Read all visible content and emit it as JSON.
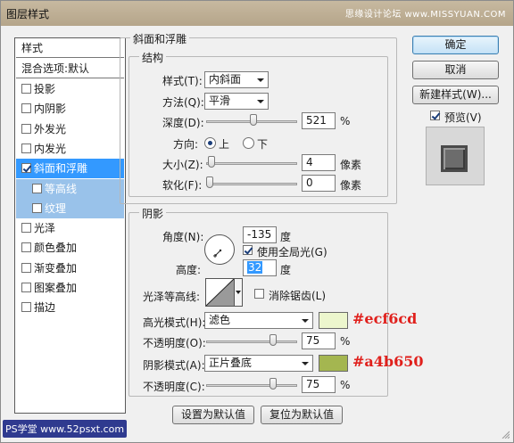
{
  "window": {
    "title": "图层样式",
    "watermark": "思缘设计论坛 www.MISSYUAN.COM"
  },
  "style_list": {
    "header": "样式",
    "blend": "混合选项:默认",
    "items": [
      {
        "label": "投影",
        "checked": false
      },
      {
        "label": "内阴影",
        "checked": false
      },
      {
        "label": "外发光",
        "checked": false
      },
      {
        "label": "内发光",
        "checked": false
      },
      {
        "label": "斜面和浮雕",
        "checked": true,
        "selected": true
      },
      {
        "label": "等高线",
        "checked": false,
        "sub": true
      },
      {
        "label": "纹理",
        "checked": false,
        "sub": true
      },
      {
        "label": "光泽",
        "checked": false
      },
      {
        "label": "颜色叠加",
        "checked": false
      },
      {
        "label": "渐变叠加",
        "checked": false
      },
      {
        "label": "图案叠加",
        "checked": false
      },
      {
        "label": "描边",
        "checked": false
      }
    ]
  },
  "bevel": {
    "group_title": "斜面和浮雕",
    "structure_title": "结构",
    "style_label": "样式(T):",
    "style_value": "内斜面",
    "method_label": "方法(Q):",
    "method_value": "平滑",
    "depth_label": "深度(D):",
    "depth_value": "521",
    "depth_unit": "%",
    "depth_fraction": 0.52,
    "direction_label": "方向:",
    "direction_up": "上",
    "direction_down": "下",
    "size_label": "大小(Z):",
    "size_value": "4",
    "size_unit": "像素",
    "size_fraction": 0.02,
    "soften_label": "软化(F):",
    "soften_value": "0",
    "soften_unit": "像素",
    "soften_fraction": 0.0
  },
  "shading": {
    "title": "阴影",
    "angle_label": "角度(N):",
    "angle_value": "-135",
    "angle_unit": "度",
    "global_light_label": "使用全局光(G)",
    "global_light_checked": true,
    "altitude_label": "高度:",
    "altitude_value": "32",
    "altitude_unit": "度",
    "gloss_contour_label": "光泽等高线:",
    "antialias_label": "消除锯齿(L)",
    "antialias_checked": false,
    "highlight_mode_label": "高光模式(H):",
    "highlight_mode_value": "滤色",
    "highlight_color": "#ecf6cd",
    "highlight_hex_note": "#ecf6cd",
    "highlight_opacity_label": "不透明度(O):",
    "highlight_opacity_value": "75",
    "highlight_opacity_unit": "%",
    "highlight_opacity_fraction": 0.75,
    "shadow_mode_label": "阴影模式(A):",
    "shadow_mode_value": "正片叠底",
    "shadow_color": "#a4b650",
    "shadow_hex_note": "#a4b650",
    "shadow_opacity_label": "不透明度(C):",
    "shadow_opacity_value": "75",
    "shadow_opacity_unit": "%",
    "shadow_opacity_fraction": 0.75
  },
  "bottom_buttons": {
    "set_default": "设置为默认值",
    "reset_default": "复位为默认值"
  },
  "right_buttons": {
    "ok": "确定",
    "cancel": "取消",
    "new_style": "新建样式(W)...",
    "preview_label": "预览(V)",
    "preview_checked": true
  },
  "footer_logo": "PS学堂 www.52psxt.com",
  "colors": {
    "selection": "#3399ff",
    "sub_selection": "#99c2ea",
    "hex_note": "#e0201c"
  }
}
